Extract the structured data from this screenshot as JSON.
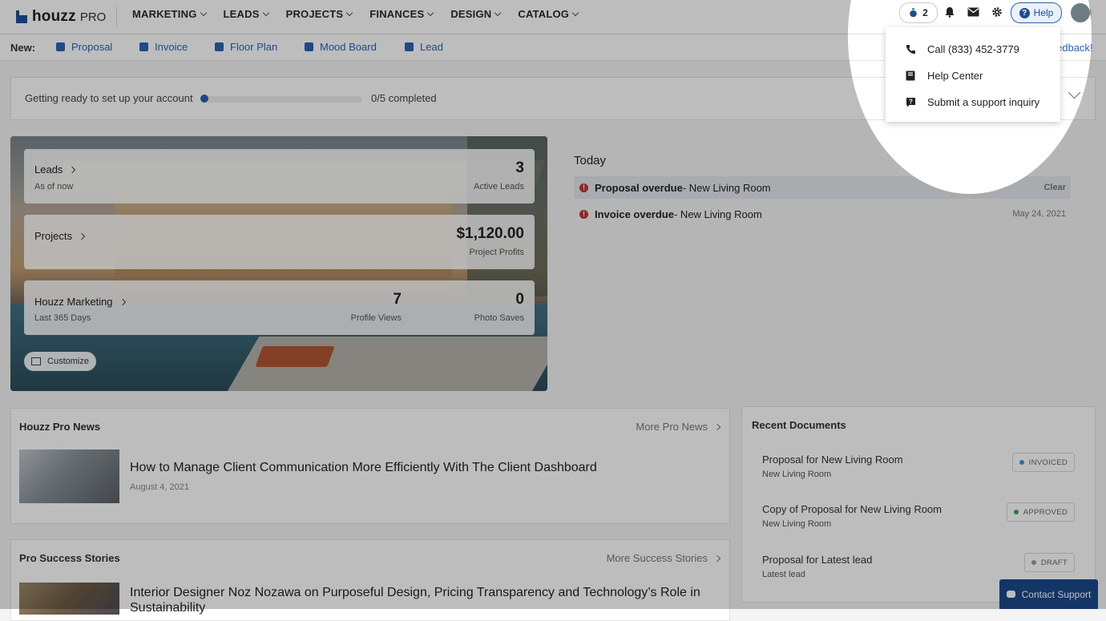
{
  "nav": {
    "brand": "houzz",
    "brand_suffix": "PRO",
    "menu": [
      "MARKETING",
      "LEADS",
      "PROJECTS",
      "FINANCES",
      "DESIGN",
      "CATALOG"
    ],
    "timer_count": "2",
    "help_label": "Help"
  },
  "newbar": {
    "label": "New:",
    "items": [
      "Proposal",
      "Invoice",
      "Floor Plan",
      "Mood Board",
      "Lead"
    ],
    "feedback": "edback!"
  },
  "setup": {
    "text": "Getting ready to set up your account",
    "progress": 0,
    "count": "0/5 completed"
  },
  "help_menu": {
    "items": [
      {
        "label": "Call (833) 452-3779",
        "icon": "phone-icon"
      },
      {
        "label": "Help Center",
        "icon": "book-icon"
      },
      {
        "label": "Submit a support inquiry",
        "icon": "question-box-icon"
      }
    ]
  },
  "hero": {
    "leads": {
      "title": "Leads",
      "sub": "As of now",
      "value": "3",
      "value_label": "Active Leads"
    },
    "projects": {
      "title": "Projects",
      "value": "$1,120.00",
      "value_label": "Project Profits"
    },
    "marketing": {
      "title": "Houzz Marketing",
      "sub": "Last 365 Days",
      "views": "7",
      "views_label": "Profile Views",
      "saves": "0",
      "saves_label": "Photo Saves"
    },
    "customize": "Customize"
  },
  "today": {
    "title": "Today",
    "items": [
      {
        "bold": "Proposal overdue",
        "rest": " - New Living Room",
        "right": "Clear"
      },
      {
        "bold": "Invoice overdue",
        "rest": " - New Living Room",
        "right": "May 24, 2021"
      }
    ]
  },
  "news": {
    "title": "Houzz Pro News",
    "more": "More Pro News",
    "headline": "How to Manage Client Communication More Efficiently With The Client Dashboard",
    "date": "August 4, 2021"
  },
  "stories": {
    "title": "Pro Success Stories",
    "more": "More Success Stories",
    "headline": "Interior Designer Noz Nozawa on Purposeful Design, Pricing Transparency and Technology’s Role in Sustainability"
  },
  "docs": {
    "title": "Recent Documents",
    "items": [
      {
        "title": "Proposal for New Living Room",
        "sub": "New Living Room",
        "status": "INVOICED",
        "color": "#3a9bd9"
      },
      {
        "title": "Copy of Proposal for New Living Room",
        "sub": "New Living Room",
        "status": "APPROVED",
        "color": "#3aa84a"
      },
      {
        "title": "Proposal for Latest lead",
        "sub": "Latest lead",
        "status": "DRAFT",
        "color": "#999999"
      }
    ]
  },
  "contact_support": "Contact Support"
}
